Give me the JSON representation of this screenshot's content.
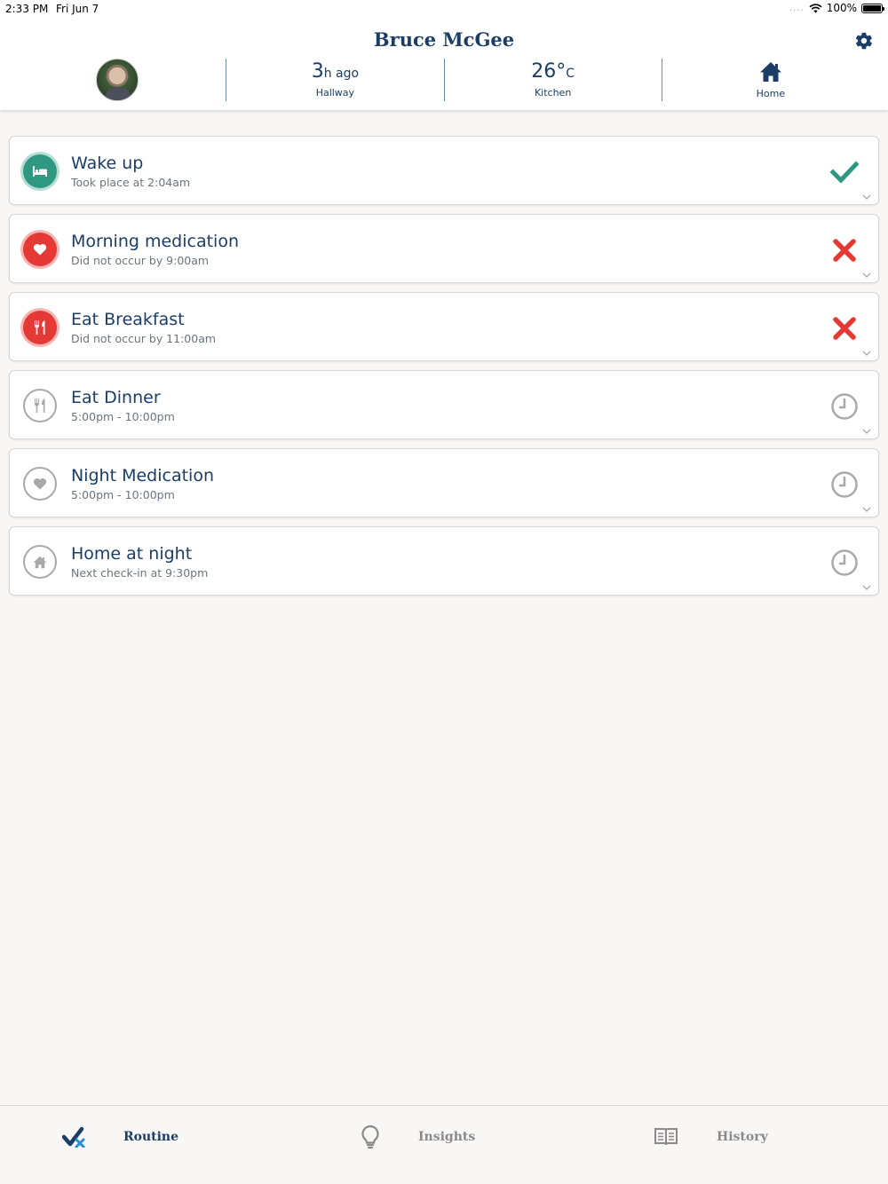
{
  "status_bar": {
    "time": "2:33 PM",
    "date": "Fri Jun 7",
    "signal": "....",
    "battery": "100%"
  },
  "header": {
    "name": "Bruce McGee",
    "stats": [
      {
        "type": "avatar"
      },
      {
        "value": "3",
        "unit": "h ago",
        "label": "Hallway"
      },
      {
        "value": "26°",
        "unit": "C",
        "label": "Kitchen"
      },
      {
        "icon": "home-icon",
        "label": "Home"
      }
    ]
  },
  "routine": [
    {
      "title": "Wake up",
      "subtitle": "Took place at 2:04am",
      "icon": "bed-icon",
      "state": "done",
      "status_icon": "check-icon"
    },
    {
      "title": "Morning medication",
      "subtitle": "Did not occur by 9:00am",
      "icon": "heart-icon",
      "state": "missed",
      "status_icon": "cross-icon"
    },
    {
      "title": "Eat Breakfast",
      "subtitle": "Did not occur by 11:00am",
      "icon": "utensils-icon",
      "state": "missed",
      "status_icon": "cross-icon"
    },
    {
      "title": "Eat Dinner",
      "subtitle": "5:00pm - 10:00pm",
      "icon": "utensils-icon",
      "state": "pending",
      "status_icon": "clock-icon"
    },
    {
      "title": "Night Medication",
      "subtitle": "5:00pm - 10:00pm",
      "icon": "heart-icon",
      "state": "pending",
      "status_icon": "clock-icon"
    },
    {
      "title": "Home at night",
      "subtitle": "Next check-in at 9:30pm",
      "icon": "home-icon",
      "state": "pending",
      "status_icon": "clock-icon"
    }
  ],
  "tabs": [
    {
      "label": "Routine",
      "icon": "routine-check-icon",
      "active": true
    },
    {
      "label": "Insights",
      "icon": "lightbulb-icon",
      "active": false
    },
    {
      "label": "History",
      "icon": "book-icon",
      "active": false
    }
  ],
  "colors": {
    "navy": "#1b3d66",
    "green": "#2e9980",
    "red": "#e53935",
    "grey": "#a9a9a9",
    "background": "#f8f7f6"
  }
}
